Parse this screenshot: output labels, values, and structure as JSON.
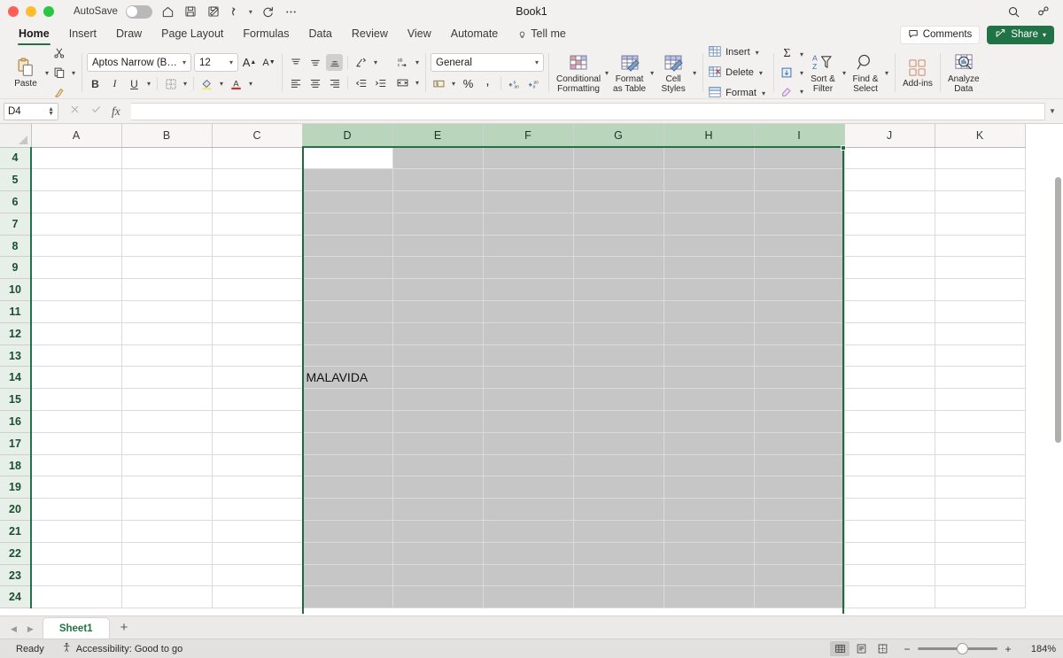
{
  "window": {
    "title": "Book1",
    "autosave_label": "AutoSave",
    "autosave_state": "off",
    "traffic_lights": [
      "close-red",
      "minimize-yellow",
      "maximize-green"
    ],
    "qat": [
      "home-icon",
      "save-icon",
      "save-as-icon",
      "undo-icon",
      "redo-icon",
      "more-icon"
    ],
    "search_icon": "search-icon",
    "collaborate_icon": "collaborate-icon"
  },
  "tabs": {
    "items": [
      {
        "label": "Home",
        "active": true
      },
      {
        "label": "Insert",
        "active": false
      },
      {
        "label": "Draw",
        "active": false
      },
      {
        "label": "Page Layout",
        "active": false
      },
      {
        "label": "Formulas",
        "active": false
      },
      {
        "label": "Data",
        "active": false
      },
      {
        "label": "Review",
        "active": false
      },
      {
        "label": "View",
        "active": false
      },
      {
        "label": "Automate",
        "active": false
      },
      {
        "label": "Tell me",
        "active": false,
        "icon": "lightbulb-icon"
      }
    ],
    "comments_label": "Comments",
    "share_label": "Share"
  },
  "ribbon": {
    "clipboard": {
      "paste_label": "Paste",
      "cut_label": "Cut",
      "copy_label": "Copy",
      "format_painter_label": "Format Painter"
    },
    "font": {
      "font_name": "Aptos Narrow (Bod...",
      "font_size": "12",
      "grow_label": "Increase Font Size",
      "shrink_label": "Decrease Font Size",
      "bold": "B",
      "italic": "I",
      "underline": "U",
      "borders_label": "Borders",
      "fill_color_label": "Fill Color",
      "font_color_label": "Font Color"
    },
    "alignment": {
      "top_align": "Top Align",
      "middle_align": "Middle Align",
      "bottom_align": "Bottom Align",
      "bottom_align_active": true,
      "orientation": "Orientation",
      "align_left": "Align Left",
      "align_center": "Center",
      "align_right": "Align Right",
      "decrease_indent": "Decrease Indent",
      "increase_indent": "Increase Indent",
      "wrap_text": "Wrap Text",
      "merge_center": "Merge & Center"
    },
    "number": {
      "format": "General",
      "accounting_label": "Accounting Number Format",
      "percent_label": "Percent Style",
      "comma_label": "Comma Style",
      "increase_decimal": "Increase Decimal",
      "decrease_decimal": "Decrease Decimal"
    },
    "styles": [
      {
        "label_line1": "Conditional",
        "label_line2": "Formatting",
        "name": "conditional-formatting"
      },
      {
        "label_line1": "Format",
        "label_line2": "as Table",
        "name": "format-as-table"
      },
      {
        "label_line1": "Cell",
        "label_line2": "Styles",
        "name": "cell-styles"
      }
    ],
    "cells": [
      {
        "label": "Insert",
        "name": "insert"
      },
      {
        "label": "Delete",
        "name": "delete"
      },
      {
        "label": "Format",
        "name": "format"
      }
    ],
    "editing": {
      "autosum_label": "AutoSum",
      "fill_label": "Fill",
      "clear_label": "Clear",
      "sort_filter_line1": "Sort &",
      "sort_filter_line2": "Filter",
      "find_select_line1": "Find &",
      "find_select_line2": "Select"
    },
    "addins": {
      "label": "Add-ins"
    },
    "analyze": {
      "label_line1": "Analyze",
      "label_line2": "Data"
    }
  },
  "formula_bar": {
    "name_box": "D4",
    "formula": "",
    "cancel_icon": "cancel-icon",
    "enter_icon": "confirm-icon",
    "function_icon": "fx"
  },
  "grid": {
    "columns": [
      "A",
      "B",
      "C",
      "D",
      "E",
      "F",
      "G",
      "H",
      "I",
      "J",
      "K"
    ],
    "selected_columns": [
      "D",
      "E",
      "F",
      "G",
      "H",
      "I"
    ],
    "rows": [
      "4",
      "5",
      "6",
      "7",
      "8",
      "9",
      "10",
      "11",
      "12",
      "13",
      "14",
      "15",
      "16",
      "17",
      "18",
      "19",
      "20",
      "21",
      "22",
      "23",
      "24"
    ],
    "active_cell": "D4",
    "cell_values": [
      {
        "ref": "D14",
        "row": "14",
        "column": "D",
        "value": "MALAVIDA"
      }
    ]
  },
  "sheet_tabs": {
    "tabs": [
      {
        "label": "Sheet1",
        "active": true
      }
    ],
    "add_label": "+",
    "prev_label": "◀",
    "next_label": "▶"
  },
  "status_bar": {
    "mode": "Ready",
    "accessibility": "Accessibility: Good to go",
    "views": [
      {
        "name": "normal-view",
        "active": true
      },
      {
        "name": "page-layout-view",
        "active": false
      },
      {
        "name": "page-break-view",
        "active": false
      }
    ],
    "zoom_out": "−",
    "zoom_in": "+",
    "zoom_level": "184%"
  },
  "colors": {
    "accent_green": "#217346",
    "header_selected": "#b9d6bd",
    "selection_fill": "#c6c6c6",
    "chrome": "#f2f1f0"
  }
}
